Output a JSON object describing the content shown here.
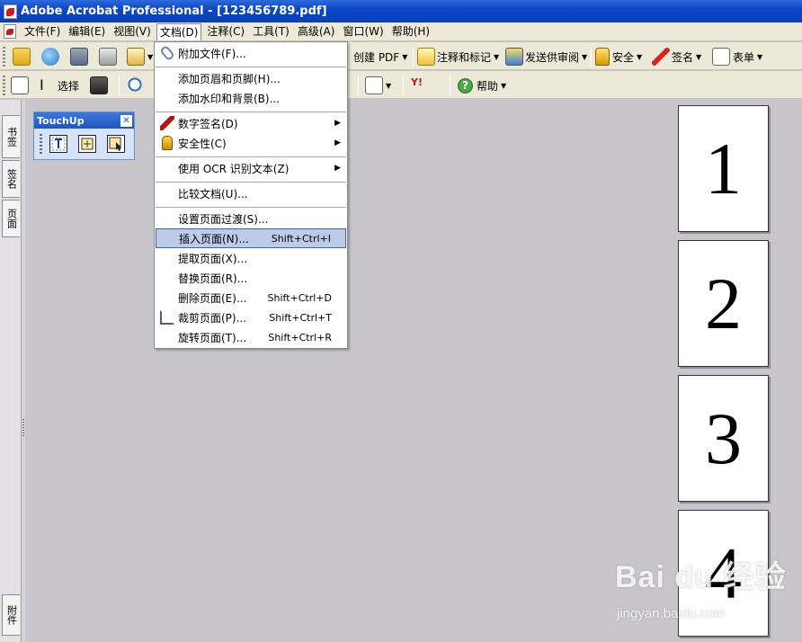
{
  "window": {
    "title": "Adobe Acrobat Professional - [123456789.pdf]"
  },
  "menubar": {
    "items": [
      "文件(F)",
      "编辑(E)",
      "视图(V)",
      "文档(D)",
      "注释(C)",
      "工具(T)",
      "高级(A)",
      "窗口(W)",
      "帮助(H)"
    ],
    "open_index": 3
  },
  "toolbar1": {
    "create_pdf": "创建 PDF",
    "comment_markup": "注释和标记",
    "send_review": "发送供审阅",
    "security": "安全",
    "sign": "签名",
    "forms": "表单"
  },
  "toolbar2": {
    "select": "选择",
    "help": "帮助",
    "yahoo": "Y!"
  },
  "nav_tabs": [
    "书签",
    "签名",
    "页面",
    "附件"
  ],
  "touchup": {
    "title": "TouchUp",
    "close": "✕",
    "tools": [
      "touchup-text-tool",
      "touchup-object-tool",
      "touchup-reading-order-tool"
    ]
  },
  "pages": [
    "1",
    "2",
    "3",
    "4"
  ],
  "document_menu": {
    "items": [
      {
        "label": "附加文件(F)...",
        "shortcut": "",
        "icon": "paperclip-icon",
        "submenu": false
      },
      {
        "label": "添加页眉和页脚(H)...",
        "shortcut": "",
        "icon": "",
        "submenu": false
      },
      {
        "label": "添加水印和背景(B)...",
        "shortcut": "",
        "icon": "",
        "submenu": false
      },
      {
        "label": "数字签名(D)",
        "shortcut": "",
        "icon": "pen-icon",
        "submenu": true
      },
      {
        "label": "安全性(C)",
        "shortcut": "",
        "icon": "lock-icon",
        "submenu": true
      },
      {
        "label": "使用 OCR 识别文本(Z)",
        "shortcut": "",
        "icon": "",
        "submenu": true
      },
      {
        "label": "比较文档(U)...",
        "shortcut": "",
        "icon": "",
        "submenu": false
      },
      {
        "label": "设置页面过渡(S)...",
        "shortcut": "",
        "icon": "",
        "submenu": false
      },
      {
        "label": "插入页面(N)...",
        "shortcut": "Shift+Ctrl+I",
        "icon": "",
        "submenu": false,
        "highlighted": true
      },
      {
        "label": "提取页面(X)...",
        "shortcut": "",
        "icon": "",
        "submenu": false
      },
      {
        "label": "替换页面(R)...",
        "shortcut": "",
        "icon": "",
        "submenu": false
      },
      {
        "label": "删除页面(E)...",
        "shortcut": "Shift+Ctrl+D",
        "icon": "",
        "submenu": false
      },
      {
        "label": "裁剪页面(P)...",
        "shortcut": "Shift+Ctrl+T",
        "icon": "crop-icon",
        "submenu": false
      },
      {
        "label": "旋转页面(T)...",
        "shortcut": "Shift+Ctrl+R",
        "icon": "",
        "submenu": false
      }
    ],
    "submenu_arrow": "▶"
  },
  "watermark": {
    "brand": "Bai du 经验",
    "url": "jingyan.baidu.com"
  },
  "colors": {
    "titlebar": "#0a46c8",
    "menu_highlight": "#bccbe9",
    "workspace": "#c8c6cb"
  }
}
